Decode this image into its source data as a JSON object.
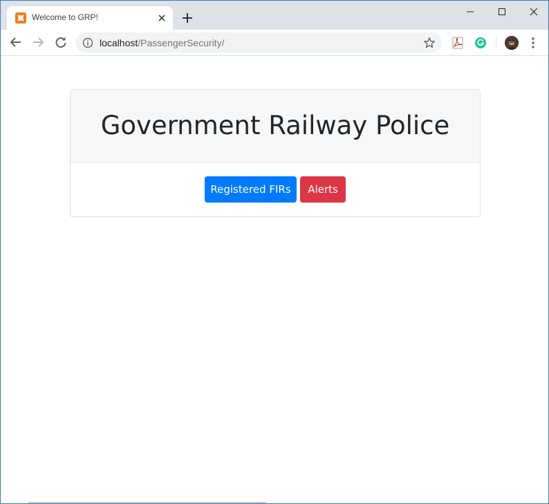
{
  "browser": {
    "tab": {
      "title": "Welcome to GRP!",
      "favicon_icon": "xampp-logo-icon"
    },
    "address_bar": {
      "host": "localhost",
      "path": "/PassengerSecurity/"
    },
    "extensions": [
      "adobe-pdf-icon",
      "grammarly-icon"
    ]
  },
  "page": {
    "title": "Government Railway Police",
    "buttons": {
      "registered_firs": "Registered FIRs",
      "alerts": "Alerts"
    }
  },
  "colors": {
    "primary": "#007bff",
    "danger": "#dc3545",
    "card_header_bg": "#f7f7f7",
    "tabstrip_bg": "#dee1e6"
  }
}
